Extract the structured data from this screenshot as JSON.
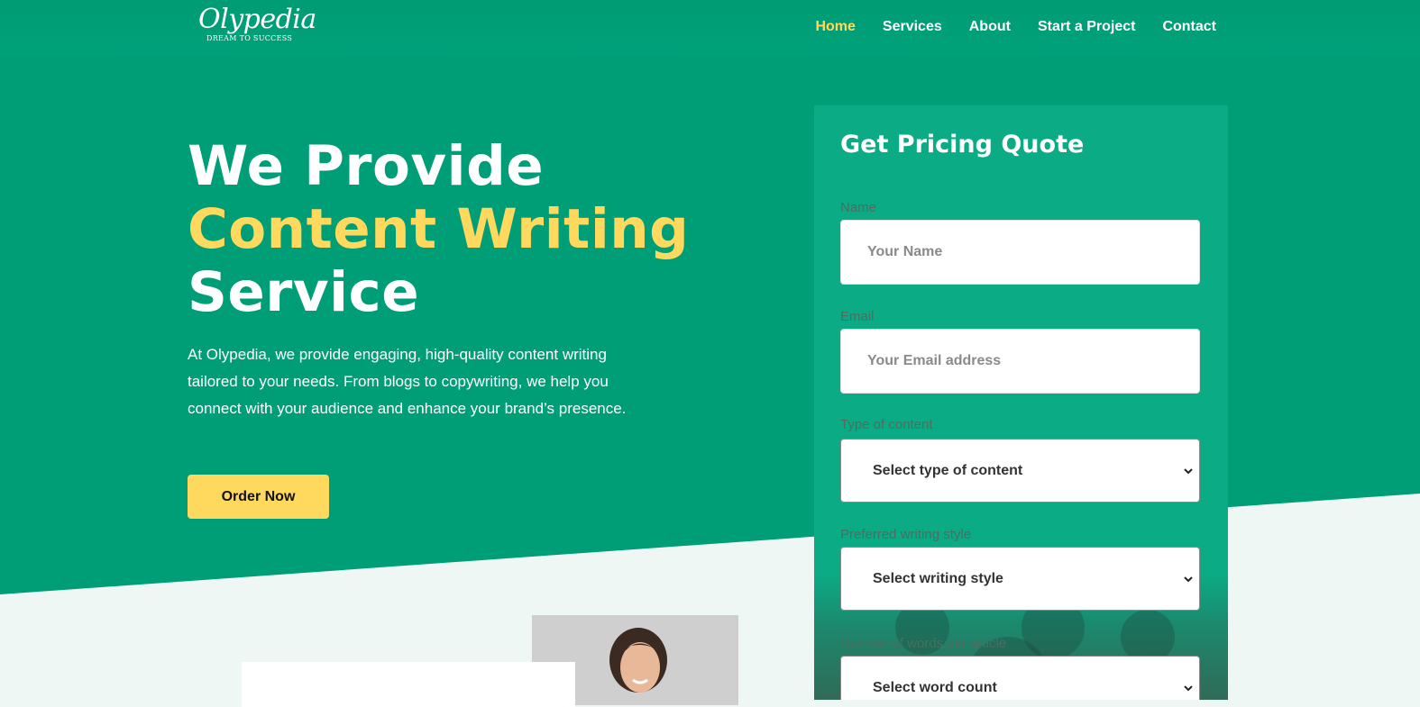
{
  "brand": {
    "name": "Olypedia",
    "tagline": "DREAM TO SUCCESS"
  },
  "nav": {
    "items": [
      {
        "label": "Home",
        "active": true
      },
      {
        "label": "Services",
        "active": false
      },
      {
        "label": "About",
        "active": false
      },
      {
        "label": "Start a Project",
        "active": false
      },
      {
        "label": "Contact",
        "active": false
      }
    ]
  },
  "hero": {
    "title_line1": "We Provide",
    "title_line2": "Content Writing",
    "title_line3": "Service",
    "description": "At Olypedia, we provide engaging, high-quality content writing tailored to your needs. From blogs to copywriting, we help you connect with your audience and enhance your brand’s presence.",
    "cta_label": "Order Now"
  },
  "quote_form": {
    "title": "Get Pricing Quote",
    "name": {
      "label": "Name",
      "placeholder": "Your Name"
    },
    "email": {
      "label": "Email",
      "placeholder": "Your Email address"
    },
    "content_type": {
      "label": "Type of content",
      "selected": "Select type of content"
    },
    "writing_style": {
      "label": "Preferred writing style",
      "selected": "Select writing style"
    },
    "word_count": {
      "label": "Number of words per article",
      "selected": "Select word count"
    }
  },
  "colors": {
    "primary_green": "#009e77",
    "card_green": "#0bab85",
    "accent_yellow": "#ffd95e",
    "light_bg": "#eef7f3"
  },
  "icons": {
    "select_chevron": "chevron-down-icon"
  }
}
